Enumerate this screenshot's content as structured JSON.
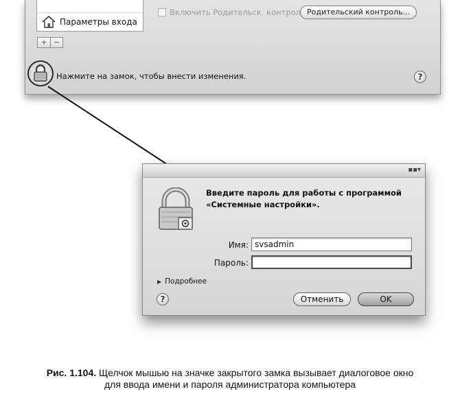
{
  "preferences": {
    "sidebar": {
      "login_options_label": "Параметры входа"
    },
    "toolbar": {
      "add_label": "+",
      "remove_label": "−"
    },
    "parental_controls": {
      "checkbox_label": "Включить Родительск. контроль",
      "button_label": "Родительский контроль..."
    },
    "lock_hint": "Нажмите на замок, чтобы внести изменения.",
    "help_label": "?"
  },
  "auth_dialog": {
    "prompt_line1": "Введите пароль для работы с программой",
    "prompt_line2": "«Системные настройки».",
    "name_label": "Имя:",
    "name_value": "svsadmin",
    "password_label": "Пароль:",
    "password_value": "",
    "details_label": "Подробнее",
    "help_label": "?",
    "cancel_label": "Отменить",
    "ok_label": "OK",
    "input_flag_label": "▪▪▾"
  },
  "caption": {
    "figure_number": "Рис. 1.104.",
    "line1_rest": " Щелчок мышью на значке закрытого замка вызывает диалоговое окно",
    "line2": "для ввода имени и пароля администратора компьютера"
  },
  "icons": {
    "home": "home-icon",
    "lock_small": "lock-icon",
    "lock_big": "lock-icon",
    "disclosure": "disclosure-triangle-icon",
    "help": "help-icon"
  }
}
